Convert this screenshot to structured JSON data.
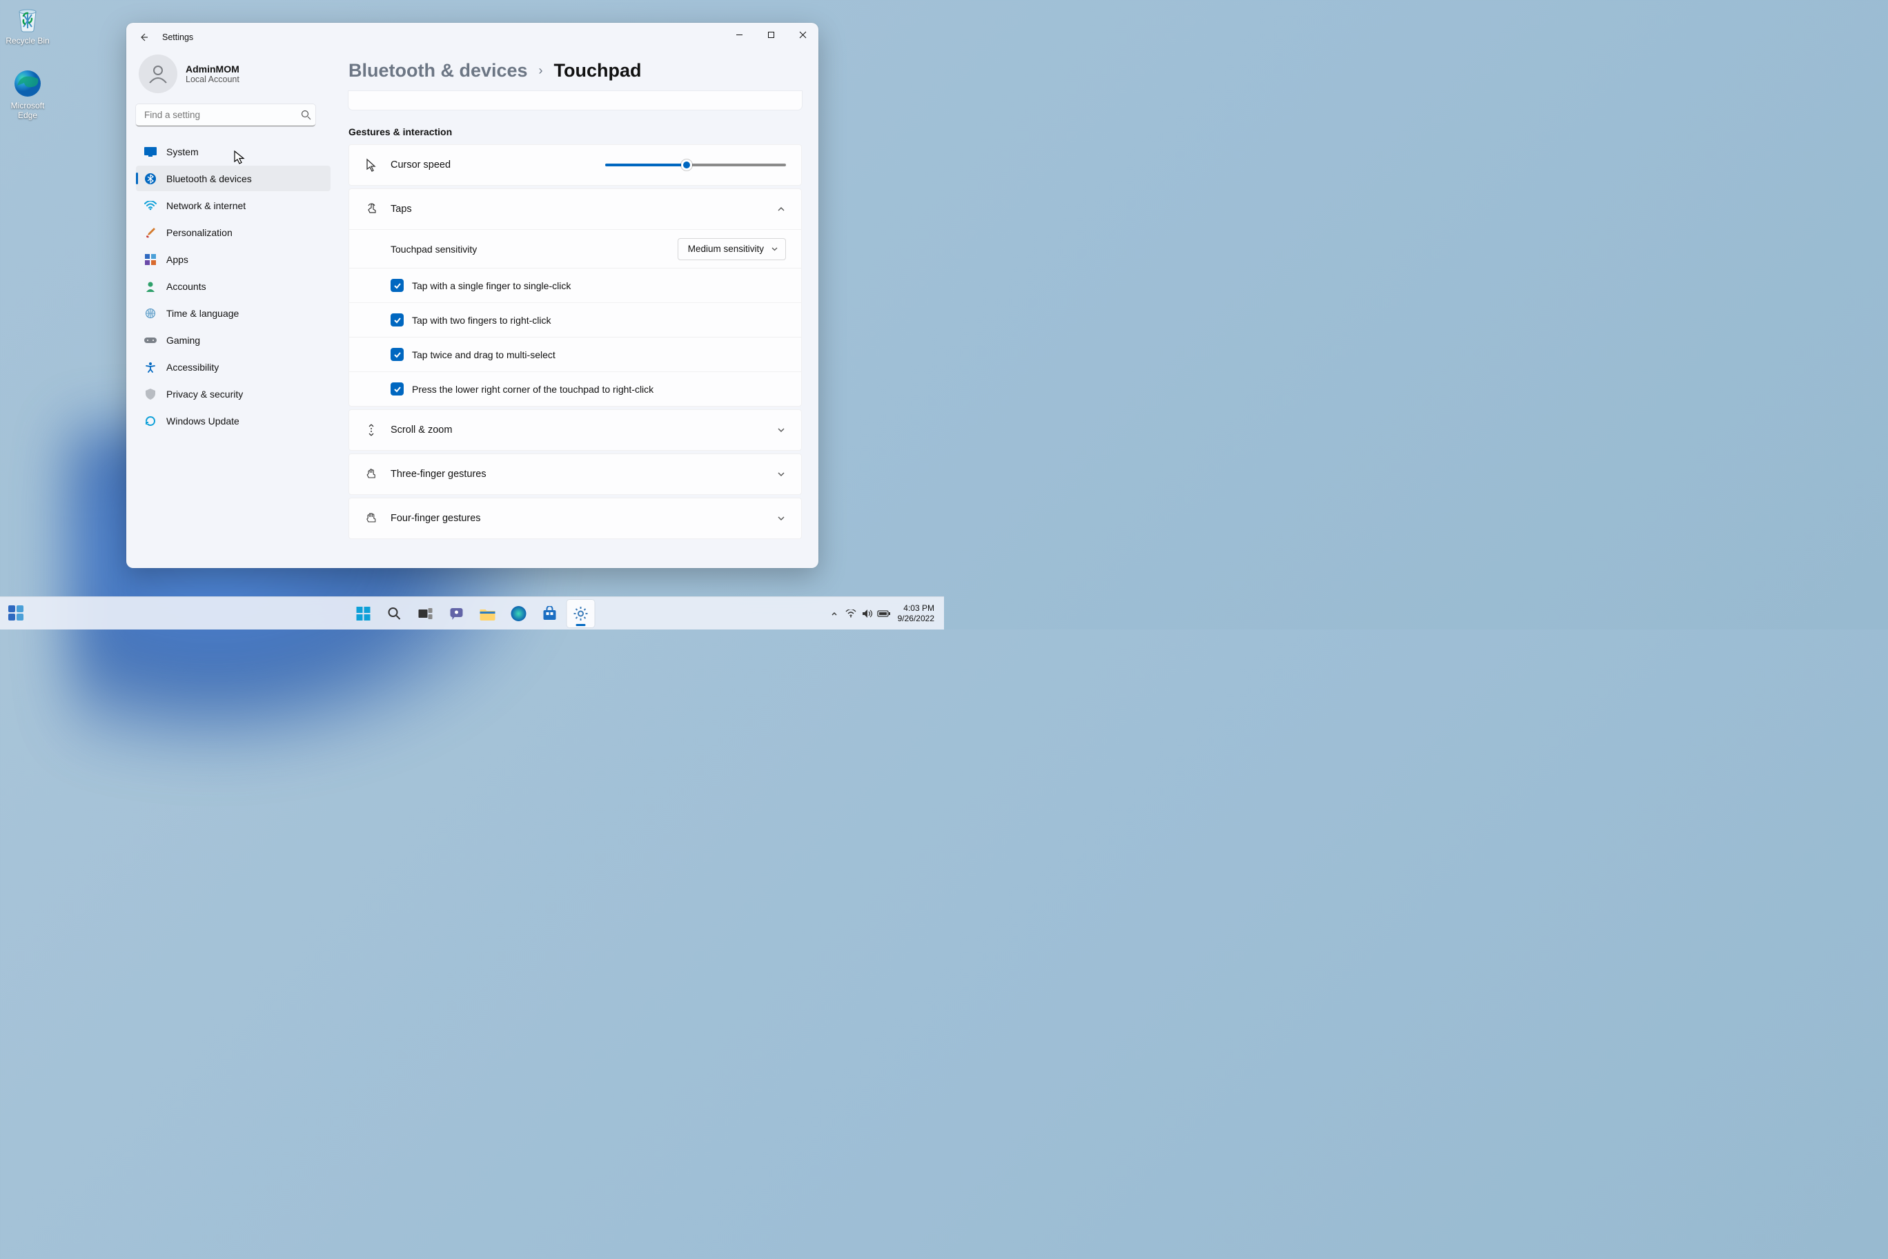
{
  "desktop": {
    "icons": [
      {
        "label": "Recycle Bin"
      },
      {
        "label": "Microsoft Edge"
      }
    ]
  },
  "window": {
    "title": "Settings",
    "user": {
      "name": "AdminMOM",
      "type": "Local Account"
    },
    "search_placeholder": "Find a setting",
    "nav": [
      {
        "label": "System",
        "icon": "display"
      },
      {
        "label": "Bluetooth & devices",
        "icon": "bluetooth",
        "active": true
      },
      {
        "label": "Network & internet",
        "icon": "wifi"
      },
      {
        "label": "Personalization",
        "icon": "brush"
      },
      {
        "label": "Apps",
        "icon": "apps"
      },
      {
        "label": "Accounts",
        "icon": "person"
      },
      {
        "label": "Time & language",
        "icon": "globe"
      },
      {
        "label": "Gaming",
        "icon": "game"
      },
      {
        "label": "Accessibility",
        "icon": "accessibility"
      },
      {
        "label": "Privacy & security",
        "icon": "shield"
      },
      {
        "label": "Windows Update",
        "icon": "update"
      }
    ],
    "breadcrumb": {
      "parent": "Bluetooth & devices",
      "current": "Touchpad"
    },
    "section_label": "Gestures & interaction",
    "cursor_speed": {
      "label": "Cursor speed",
      "value": 45
    },
    "taps": {
      "label": "Taps",
      "sensitivity_label": "Touchpad sensitivity",
      "sensitivity_value": "Medium sensitivity",
      "options": [
        {
          "label": "Tap with a single finger to single-click",
          "checked": true
        },
        {
          "label": "Tap with two fingers to right-click",
          "checked": true
        },
        {
          "label": "Tap twice and drag to multi-select",
          "checked": true
        },
        {
          "label": "Press the lower right corner of the touchpad to right-click",
          "checked": true
        }
      ]
    },
    "rows": [
      {
        "label": "Scroll & zoom"
      },
      {
        "label": "Three-finger gestures"
      },
      {
        "label": "Four-finger gestures"
      }
    ]
  },
  "taskbar": {
    "time": "4:03 PM",
    "date": "9/26/2022"
  }
}
